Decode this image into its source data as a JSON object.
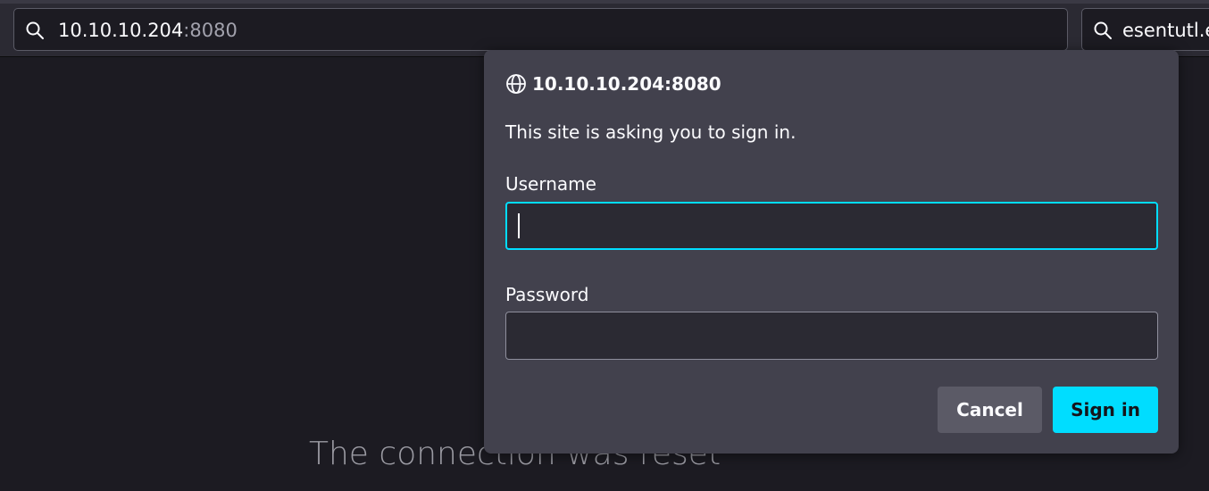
{
  "browser": {
    "url_host": "10.10.10.204",
    "url_port": ":8080",
    "search_text": "esentutl.e"
  },
  "page": {
    "error_title": "The connection was reset"
  },
  "dialog": {
    "origin": "10.10.10.204:8080",
    "message": "This site is asking you to sign in.",
    "username_label": "Username",
    "username_value": "",
    "password_label": "Password",
    "password_value": "",
    "cancel_label": "Cancel",
    "signin_label": "Sign in"
  },
  "colors": {
    "accent": "#00ddff",
    "dialog_bg": "#42414d",
    "page_bg": "#1c1b22"
  },
  "icons": {
    "url": "search-icon",
    "search": "search-icon",
    "origin": "globe-icon"
  }
}
